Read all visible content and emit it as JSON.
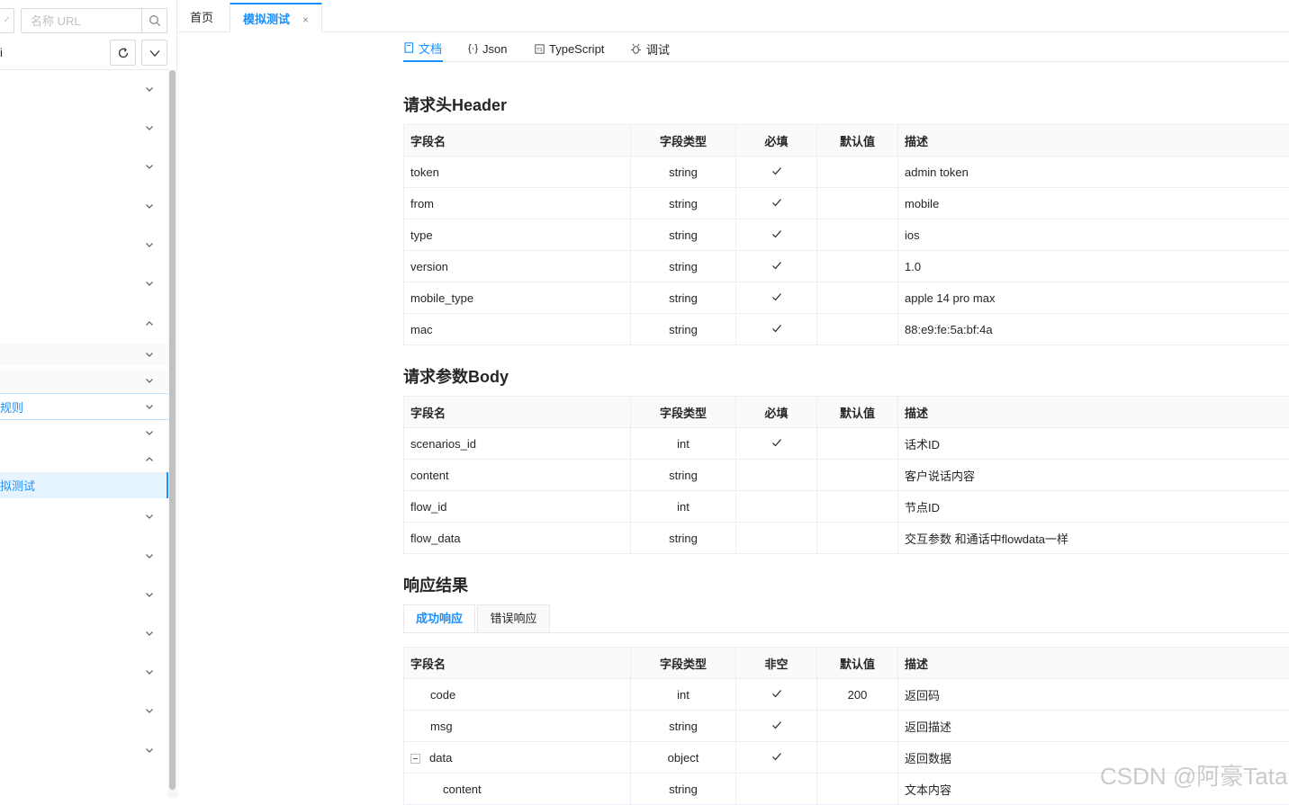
{
  "sidebar": {
    "select_arrow": "✓",
    "search_placeholder": "名称 URL",
    "row2_label": "i",
    "menu_items": [
      {
        "label": "",
        "chevron": "down"
      },
      {
        "label": "",
        "chevron": "down"
      },
      {
        "label": "",
        "chevron": "down"
      },
      {
        "label": "",
        "chevron": "down"
      },
      {
        "label": "",
        "chevron": "down"
      },
      {
        "label": "",
        "chevron": "down"
      },
      {
        "label": "",
        "chevron": "up"
      },
      {
        "label": "",
        "chevron": "down"
      },
      {
        "label": "",
        "chevron": "down"
      },
      {
        "label": "规则",
        "chevron": "down"
      },
      {
        "label": "",
        "chevron": "down"
      },
      {
        "label": "",
        "chevron": "up"
      },
      {
        "label": "拟测试",
        "chevron": ""
      },
      {
        "label": "",
        "chevron": "down"
      },
      {
        "label": "",
        "chevron": "down"
      },
      {
        "label": "",
        "chevron": "down"
      },
      {
        "label": "",
        "chevron": "down"
      },
      {
        "label": "",
        "chevron": "down"
      },
      {
        "label": "",
        "chevron": "down"
      },
      {
        "label": "",
        "chevron": "down"
      }
    ]
  },
  "tabs": {
    "home": "首页",
    "active": "模拟测试",
    "close": "×"
  },
  "subtabs": {
    "doc": "文档",
    "json": "Json",
    "ts": "TypeScript",
    "debug": "调试"
  },
  "header_section": {
    "title": "请求头Header",
    "columns": [
      "字段名",
      "字段类型",
      "必填",
      "默认值",
      "描述"
    ],
    "rows": [
      {
        "name": "token",
        "type": "string",
        "required": true,
        "default": "",
        "desc": "admin token"
      },
      {
        "name": "from",
        "type": "string",
        "required": true,
        "default": "",
        "desc": "mobile"
      },
      {
        "name": "type",
        "type": "string",
        "required": true,
        "default": "",
        "desc": "ios"
      },
      {
        "name": "version",
        "type": "string",
        "required": true,
        "default": "",
        "desc": "1.0"
      },
      {
        "name": "mobile_type",
        "type": "string",
        "required": true,
        "default": "",
        "desc": "apple 14 pro max"
      },
      {
        "name": "mac",
        "type": "string",
        "required": true,
        "default": "",
        "desc": "88:e9:fe:5a:bf:4a"
      }
    ]
  },
  "body_section": {
    "title": "请求参数Body",
    "columns": [
      "字段名",
      "字段类型",
      "必填",
      "默认值",
      "描述"
    ],
    "rows": [
      {
        "name": "scenarios_id",
        "type": "int",
        "required": true,
        "default": "",
        "desc": "话术ID"
      },
      {
        "name": "content",
        "type": "string",
        "required": false,
        "default": "",
        "desc": "客户说话内容"
      },
      {
        "name": "flow_id",
        "type": "int",
        "required": false,
        "default": "",
        "desc": "节点ID"
      },
      {
        "name": "flow_data",
        "type": "string",
        "required": false,
        "default": "",
        "desc": "交互参数  和通话中flowdata一样"
      }
    ]
  },
  "response_section": {
    "title": "响应结果",
    "tab_success": "成功响应",
    "tab_error": "错误响应",
    "columns": [
      "字段名",
      "字段类型",
      "非空",
      "默认值",
      "描述"
    ],
    "rows": [
      {
        "name": "code",
        "type": "int",
        "required": true,
        "default": "200",
        "desc": "返回码",
        "indent": 1,
        "toggle": false
      },
      {
        "name": "msg",
        "type": "string",
        "required": true,
        "default": "",
        "desc": "返回描述",
        "indent": 1,
        "toggle": false
      },
      {
        "name": "data",
        "type": "object",
        "required": true,
        "default": "",
        "desc": "返回数据",
        "indent": 1,
        "toggle": true
      },
      {
        "name": "content",
        "type": "string",
        "required": false,
        "default": "",
        "desc": "文本内容",
        "indent": 2,
        "toggle": false
      }
    ]
  },
  "watermark": "CSDN @阿豪Tata",
  "colors": {
    "accent": "#1890ff",
    "border": "#e8e8e8",
    "header_bg": "#fafafa"
  }
}
